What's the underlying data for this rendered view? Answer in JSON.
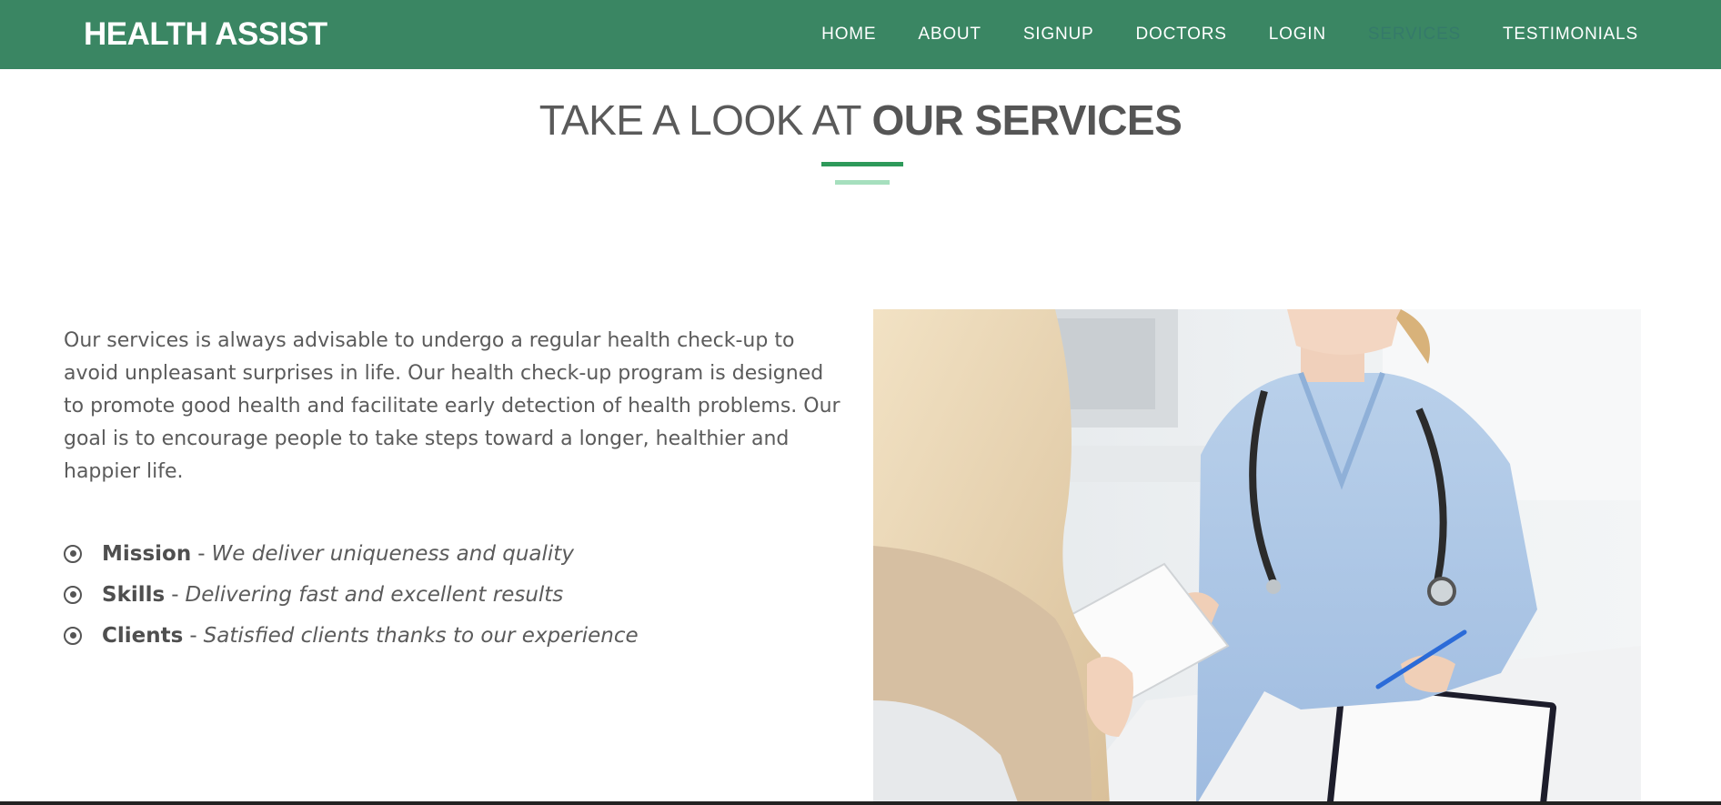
{
  "colors": {
    "nav_bg": "#3a8663",
    "accent_dark": "#2e9a5a",
    "accent_light": "#a6dfbe",
    "text": "#555555",
    "active_nav": "#357a6a"
  },
  "navbar": {
    "brand": "HEALTH ASSIST",
    "links": [
      {
        "label": "HOME",
        "active": false
      },
      {
        "label": "ABOUT",
        "active": false
      },
      {
        "label": "SIGNUP",
        "active": false
      },
      {
        "label": "DOCTORS",
        "active": false
      },
      {
        "label": "LOGIN",
        "active": false
      },
      {
        "label": "SERVICES",
        "active": true
      },
      {
        "label": "TESTIMONIALS",
        "active": false
      }
    ]
  },
  "section": {
    "title_light": "TAKE A LOOK AT ",
    "title_bold": "OUR SERVICES",
    "intro": "Our services is always advisable to undergo a regular health check-up to avoid unpleasant surprises in life. Our health check-up program is designed to promote good health and facilitate early detection of health problems. Our goal is to encourage people to take steps toward a longer, healthier and happier life.",
    "features": [
      {
        "icon": "dot-circle-icon",
        "title": "Mission",
        "separator": "-",
        "desc": "We deliver uniqueness and quality"
      },
      {
        "icon": "dot-circle-icon",
        "title": "Skills",
        "separator": "-",
        "desc": "Delivering fast and excellent results"
      },
      {
        "icon": "dot-circle-icon",
        "title": "Clients",
        "separator": "-",
        "desc": "Satisfied clients thanks to our experience"
      }
    ]
  },
  "photo": {
    "subject": "doctor-handing-paper-to-patient"
  }
}
